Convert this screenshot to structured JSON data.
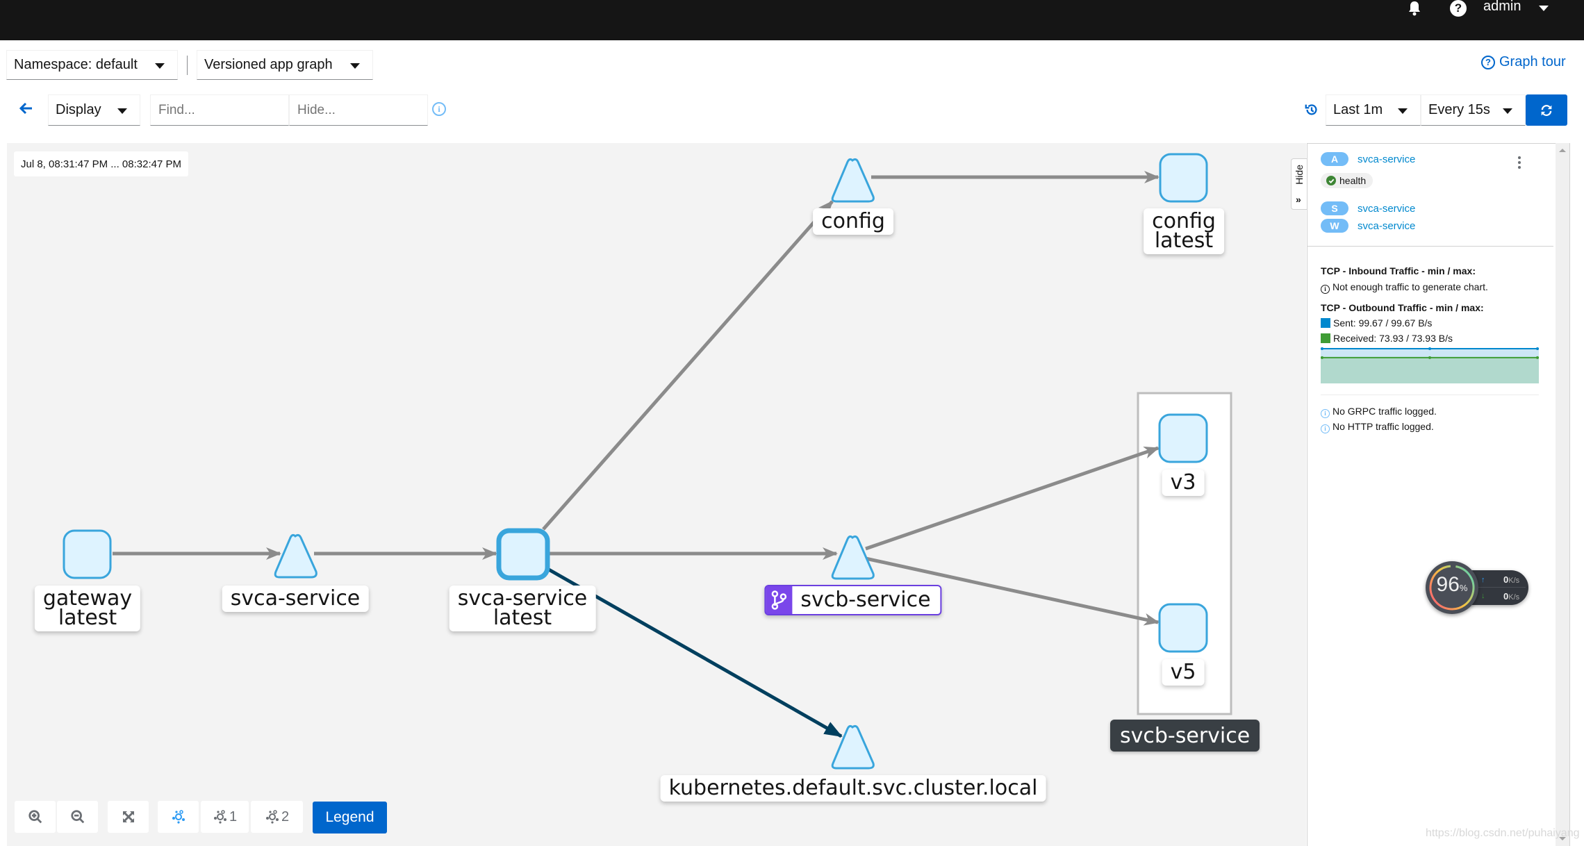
{
  "masthead": {
    "user": "admin",
    "icons": [
      "bell-icon",
      "help-icon",
      "chevron-down-icon"
    ]
  },
  "toolbar": {
    "namespace_select": "Namespace: default",
    "graph_type_select": "Versioned app graph",
    "graph_tour_label": "Graph tour",
    "display_select": "Display",
    "find_placeholder": "Find...",
    "hide_placeholder": "Hide...",
    "duration_select": "Last 1m",
    "refresh_interval_select": "Every 15s"
  },
  "graph": {
    "time_range": "Jul 8, 08:31:47 PM ... 08:32:47 PM",
    "nodes": [
      {
        "id": "gateway-latest",
        "type": "workload",
        "label_lines": [
          "gateway",
          "latest"
        ]
      },
      {
        "id": "svca-service",
        "type": "service",
        "label_lines": [
          "svca-service"
        ]
      },
      {
        "id": "svca-service-latest",
        "type": "workload",
        "selected": true,
        "label_lines": [
          "svca-service",
          "latest"
        ]
      },
      {
        "id": "config",
        "type": "service",
        "label_lines": [
          "config"
        ]
      },
      {
        "id": "config-latest",
        "type": "workload",
        "label_lines": [
          "config",
          "latest"
        ]
      },
      {
        "id": "svcb-service",
        "type": "service",
        "virtual_service": true,
        "label_lines": [
          "svcb-service"
        ]
      },
      {
        "id": "v3",
        "type": "workload",
        "label_lines": [
          "v3"
        ]
      },
      {
        "id": "v5",
        "type": "workload",
        "label_lines": [
          "v5"
        ]
      },
      {
        "id": "kubernetes",
        "type": "service",
        "label_lines": [
          "kubernetes.default.svc.cluster.local"
        ]
      }
    ],
    "edges": [
      {
        "from": "gateway-latest",
        "to": "svca-service",
        "protocol": "tcp"
      },
      {
        "from": "svca-service",
        "to": "svca-service-latest",
        "protocol": "tcp"
      },
      {
        "from": "svca-service-latest",
        "to": "config",
        "protocol": "tcp"
      },
      {
        "from": "config",
        "to": "config-latest",
        "protocol": "tcp"
      },
      {
        "from": "svca-service-latest",
        "to": "svcb-service",
        "protocol": "tcp"
      },
      {
        "from": "svcb-service",
        "to": "v3",
        "protocol": "tcp"
      },
      {
        "from": "svcb-service",
        "to": "v5",
        "protocol": "tcp"
      },
      {
        "from": "svca-service-latest",
        "to": "kubernetes",
        "protocol": "tcp",
        "highlighted": true
      }
    ],
    "app_box_label": "svcb-service",
    "controls": {
      "zoom_in": "zoom-in-icon",
      "zoom_out": "zoom-out-icon",
      "fit": "expand-icon",
      "layout_default": "topology-icon",
      "layout_1_label": "1",
      "layout_2_label": "2",
      "legend_label": "Legend"
    }
  },
  "side_panel": {
    "hide_label": "Hide",
    "badges": [
      {
        "letter": "A",
        "name": "svca-service"
      },
      {
        "letter": "S",
        "name": "svca-service"
      },
      {
        "letter": "W",
        "name": "svca-service"
      }
    ],
    "health_label": "health",
    "inbound_title": "TCP - Inbound Traffic - min / max:",
    "inbound_message": "Not enough traffic to generate chart.",
    "outbound_title": "TCP - Outbound Traffic - min / max:",
    "sent_label": "Sent: 99.67 / 99.67 B/s",
    "received_label": "Received: 73.93 / 73.93 B/s",
    "colors": {
      "sent": "#0088ce",
      "received": "#3f9c35"
    },
    "grpc_message": "No GRPC traffic logged.",
    "http_message": "No HTTP traffic logged."
  },
  "chart_data": {
    "type": "area",
    "title": "TCP - Outbound Traffic - min / max:",
    "x": [
      0,
      1,
      2
    ],
    "series": [
      {
        "name": "Sent",
        "unit": "B/s",
        "values": [
          99.67,
          99.67,
          99.67
        ],
        "color": "#0088ce"
      },
      {
        "name": "Received",
        "unit": "B/s",
        "values": [
          73.93,
          73.93,
          73.93
        ],
        "color": "#3f9c35"
      }
    ],
    "ylim": [
      0,
      99.67
    ],
    "grid": false
  },
  "net_monitor": {
    "percent": "96",
    "percent_unit": "%",
    "up_value": "0",
    "down_value": "0",
    "rate_unit": "K/s"
  },
  "watermark": "https://blog.csdn.net/puhaiyang"
}
